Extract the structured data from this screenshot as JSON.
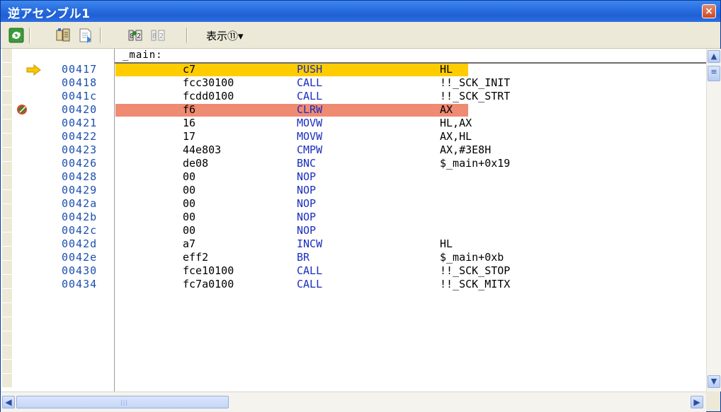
{
  "window": {
    "title": "逆アセンブル1",
    "close_glyph": "×"
  },
  "toolbar": {
    "view_label": "表示⑪▾"
  },
  "label_row": {
    "text": "_main:"
  },
  "rows": [
    {
      "addr": "00417",
      "code": "c7",
      "mnem": "PUSH",
      "oper": "HL",
      "highlight": "current"
    },
    {
      "addr": "00418",
      "code": "fcc30100",
      "mnem": "CALL",
      "oper": "!!_SCK_INIT"
    },
    {
      "addr": "0041c",
      "code": "fcdd0100",
      "mnem": "CALL",
      "oper": "!!_SCK_STRT"
    },
    {
      "addr": "00420",
      "code": "f6",
      "mnem": "CLRW",
      "oper": "AX",
      "highlight": "breakpoint"
    },
    {
      "addr": "00421",
      "code": "16",
      "mnem": "MOVW",
      "oper": "HL,AX"
    },
    {
      "addr": "00422",
      "code": "17",
      "mnem": "MOVW",
      "oper": "AX,HL"
    },
    {
      "addr": "00423",
      "code": "44e803",
      "mnem": "CMPW",
      "oper": "AX,#3E8H"
    },
    {
      "addr": "00426",
      "code": "de08",
      "mnem": "BNC",
      "oper": "$_main+0x19"
    },
    {
      "addr": "00428",
      "code": "00",
      "mnem": "NOP",
      "oper": ""
    },
    {
      "addr": "00429",
      "code": "00",
      "mnem": "NOP",
      "oper": ""
    },
    {
      "addr": "0042a",
      "code": "00",
      "mnem": "NOP",
      "oper": ""
    },
    {
      "addr": "0042b",
      "code": "00",
      "mnem": "NOP",
      "oper": ""
    },
    {
      "addr": "0042c",
      "code": "00",
      "mnem": "NOP",
      "oper": ""
    },
    {
      "addr": "0042d",
      "code": "a7",
      "mnem": "INCW",
      "oper": "HL"
    },
    {
      "addr": "0042e",
      "code": "eff2",
      "mnem": "BR",
      "oper": "$_main+0xb"
    },
    {
      "addr": "00430",
      "code": "fce10100",
      "mnem": "CALL",
      "oper": "!!_SCK_STOP"
    },
    {
      "addr": "00434",
      "code": "fc7a0100",
      "mnem": "CALL",
      "oper": "!!_SCK_MITX"
    }
  ],
  "colors": {
    "current_line": "#ffcc00",
    "breakpoint_line": "#ef8a73",
    "address": "#1b4fb0",
    "mnemonic": "#1a2ec0"
  },
  "icons": [
    "refresh-icon",
    "properties-icon",
    "save-icon",
    "symbol-icon",
    "symbol-disabled-icon",
    "current-pc-arrow-icon",
    "breakpoint-icon"
  ]
}
